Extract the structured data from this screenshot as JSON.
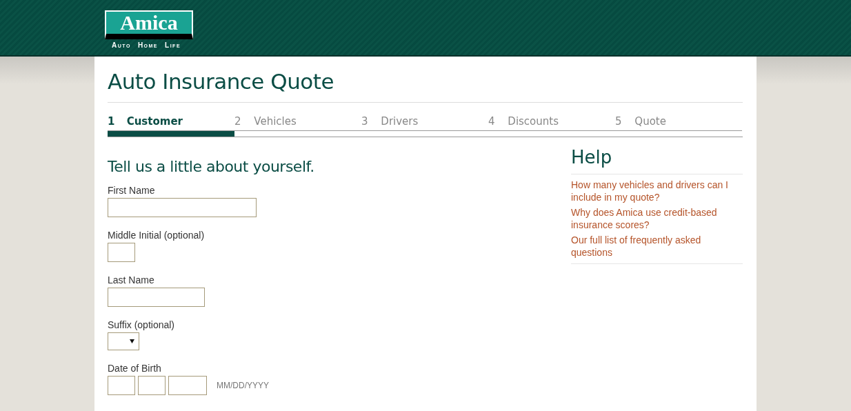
{
  "logo": {
    "name": "Amica",
    "tagline": [
      "Auto",
      "Home",
      "Life"
    ]
  },
  "title": "Auto Insurance Quote",
  "steps": [
    {
      "number": "1",
      "label": "Customer",
      "selected": true
    },
    {
      "number": "2",
      "label": "Vehicles",
      "selected": false
    },
    {
      "number": "3",
      "label": "Drivers",
      "selected": false
    },
    {
      "number": "4",
      "label": "Discounts",
      "selected": false
    },
    {
      "number": "5",
      "label": "Quote",
      "selected": false
    }
  ],
  "form": {
    "heading": "Tell us a little about yourself.",
    "fields": [
      {
        "label": "First Name",
        "kind": "text"
      },
      {
        "label": "Middle Initial (optional)",
        "kind": "text"
      },
      {
        "label": "Last Name",
        "kind": "text"
      },
      {
        "label": "Suffix (optional)",
        "kind": "select"
      },
      {
        "label": "Date of Birth",
        "kind": "date",
        "hint": "MM/DD/YYYY"
      }
    ]
  },
  "help": {
    "title": "Help",
    "links": [
      "How many vehicles and drivers can I include in my quote?",
      "Why does Amica use credit-based insurance scores?",
      "Our full list of frequently asked questions"
    ]
  }
}
